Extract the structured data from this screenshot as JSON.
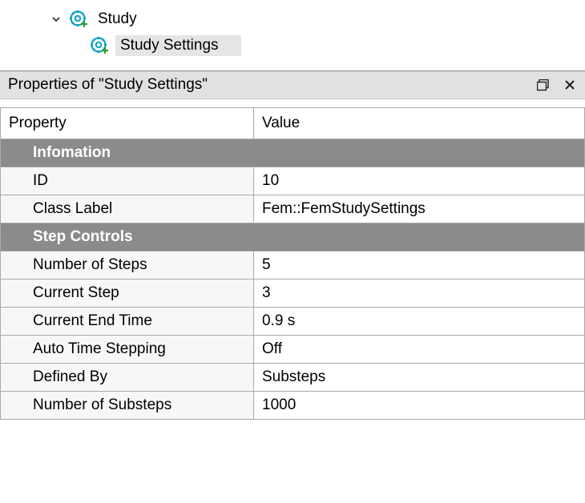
{
  "tree": {
    "study_label": "Study",
    "study_settings_label": "Study Settings"
  },
  "panel": {
    "title": "Properties of \"Study Settings\""
  },
  "table": {
    "headers": {
      "property": "Property",
      "value": "Value"
    },
    "sections": [
      {
        "title": "Infomation",
        "rows": [
          {
            "name": "ID",
            "value": "10"
          },
          {
            "name": "Class Label",
            "value": "Fem::FemStudySettings"
          }
        ]
      },
      {
        "title": "Step Controls",
        "rows": [
          {
            "name": "Number of Steps",
            "value": "5"
          },
          {
            "name": "Current Step",
            "value": "3"
          },
          {
            "name": "Current End Time",
            "value": "0.9 s"
          },
          {
            "name": "Auto Time Stepping",
            "value": "Off"
          },
          {
            "name": "Defined By",
            "value": "Substeps"
          },
          {
            "name": "Number of Substeps",
            "value": "1000"
          }
        ]
      }
    ]
  }
}
